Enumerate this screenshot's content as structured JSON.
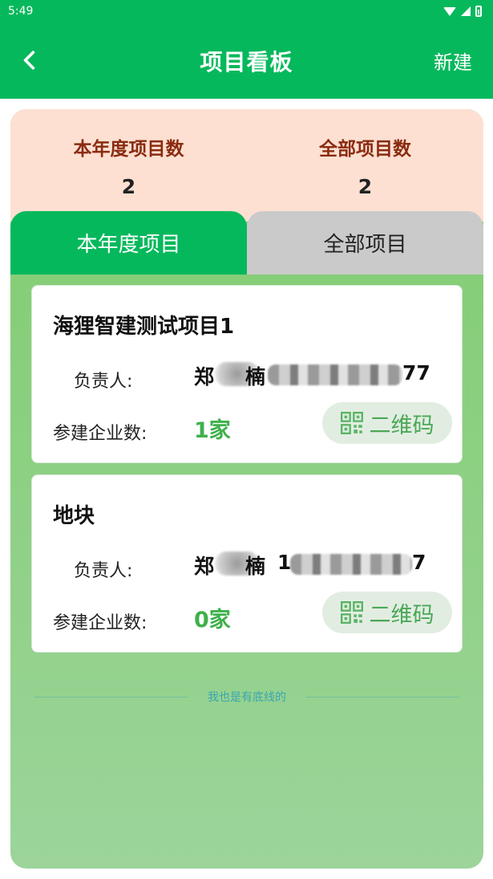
{
  "status_bar": {
    "time": "5:49"
  },
  "app_bar": {
    "title": "项目看板",
    "new_label": "新建"
  },
  "stats": [
    {
      "label": "本年度项目数",
      "value": "2"
    },
    {
      "label": "全部项目数",
      "value": "2"
    }
  ],
  "tabs": [
    {
      "label": "本年度项目",
      "active": true
    },
    {
      "label": "全部项目",
      "active": false
    }
  ],
  "cards": [
    {
      "title": "海狸智建测试项目1",
      "owner_label": "负责人:",
      "owner_name_visible": "郑",
      "owner_name_end": "楠",
      "phone_start": "",
      "phone_end": "77",
      "company_label": "参建企业数:",
      "company_count": "1家",
      "qr_label": "二维码"
    },
    {
      "title": "地块",
      "owner_label": "负责人:",
      "owner_name_visible": "郑",
      "owner_name_end": "楠",
      "phone_start": "1",
      "phone_end": "7",
      "company_label": "参建企业数:",
      "company_count": "0家",
      "qr_label": "二维码"
    }
  ],
  "footer": {
    "text": "我也是有底线的"
  },
  "colors": {
    "primary": "#06b85c",
    "stats_bg": "#fde0d2",
    "count_green": "#3eb04b"
  },
  "icons": {
    "back": "chevron-left-icon",
    "qr": "qr-code-icon"
  }
}
